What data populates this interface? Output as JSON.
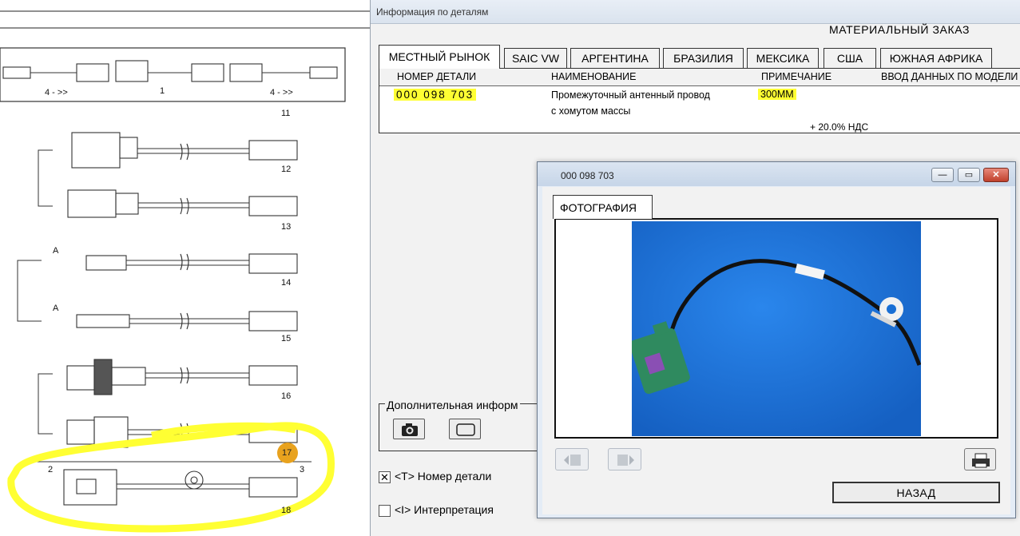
{
  "info_window": {
    "title": "Информация по деталям",
    "order_title": "МАТЕРИАЛЬНЫЙ ЗАКАЗ",
    "tabs": [
      "МЕСТНЫЙ РЫНОК",
      "SAIC VW",
      "АРГЕНТИНА",
      "БРАЗИЛИЯ",
      "МЕКСИКА",
      "США",
      "ЮЖНАЯ АФРИКА"
    ],
    "table": {
      "headers": [
        "НОМЕР ДЕТАЛИ",
        "НАИМЕНОВАНИЕ",
        "ПРИМЕЧАНИЕ",
        "ВВОД ДАННЫХ ПО МОДЕЛИ"
      ],
      "row": {
        "part_number": "000 098 703",
        "name_line1": "Промежуточный антенный провод",
        "name_line2": "с хомутом массы",
        "note": "300MM",
        "vat": "+ 20.0% НДС"
      }
    },
    "extra_info_label": "Дополнительная информ",
    "checkbox_part_number": {
      "label": "<T> Номер детали",
      "checked": true,
      "mark": "✕"
    },
    "checkbox_interpretation": {
      "label": "<I> Интерпретация",
      "checked": false,
      "mark": ""
    }
  },
  "photo_dialog": {
    "title": "000 098 703",
    "tab_label": "ФОТОГРАФИЯ",
    "back_button": "НАЗАД",
    "window_buttons": {
      "minimize": "—",
      "maximize": "▭",
      "close": "✕"
    }
  },
  "schematic": {
    "callouts": [
      "4 - >>",
      "1",
      "4 - >>",
      "11",
      "12",
      "13",
      "14",
      "15",
      "16",
      "17",
      "18",
      "2",
      "3",
      "A"
    ]
  },
  "colors": {
    "highlight": "#ffff33",
    "photo_background": "#1a6fd4",
    "connector_green": "#2f8a5f",
    "marker_orange": "#e8a21e"
  }
}
